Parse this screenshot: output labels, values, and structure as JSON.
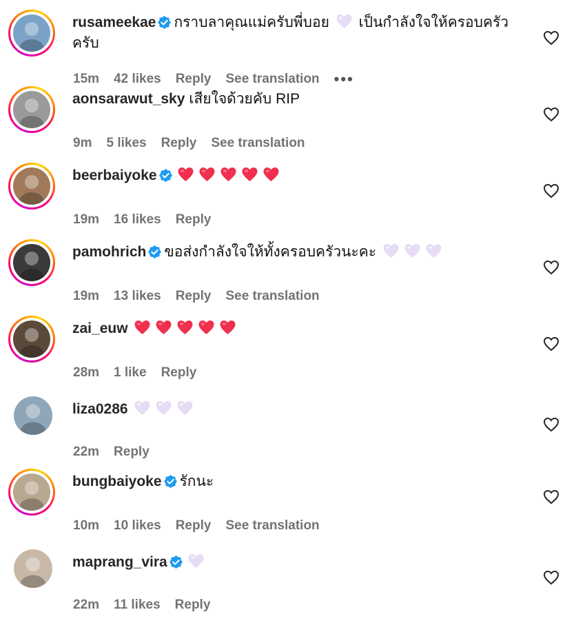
{
  "colors": {
    "red_heart": "#f0304e",
    "lavender_heart": "#e6dcf5",
    "verified_blue": "#1d9bf0",
    "meta_gray": "#737373"
  },
  "comments": [
    {
      "username": "rusameekae",
      "verified": true,
      "text": "กราบลาคุณแม่ครับพี่บอย",
      "hearts": [
        "lavender"
      ],
      "text_after": "เป็นกำลังใจให้ครอบครัวครับ",
      "time": "15m",
      "likes": "42 likes",
      "reply": "Reply",
      "translation": "See translation",
      "more": "•••",
      "story_ring": true,
      "avatar_color": "#7aa3c7"
    },
    {
      "username": "aonsarawut_sky",
      "verified": false,
      "text": "เสียใจด้วยคับ RIP",
      "hearts": [],
      "time": "9m",
      "likes": "5 likes",
      "reply": "Reply",
      "translation": "See translation",
      "story_ring": true,
      "avatar_color": "#9a9a9a"
    },
    {
      "username": "beerbaiyoke",
      "verified": true,
      "text": "",
      "hearts": [
        "red",
        "red",
        "red",
        "red",
        "red"
      ],
      "time": "19m",
      "likes": "16 likes",
      "reply": "Reply",
      "story_ring": true,
      "avatar_color": "#a07a5a"
    },
    {
      "username": "pamohrich",
      "verified": true,
      "text": "ขอส่งกำลังใจให้ทั้งครอบครัวนะคะ",
      "hearts": [
        "lavender",
        "lavender",
        "lavender"
      ],
      "time": "19m",
      "likes": "13 likes",
      "reply": "Reply",
      "translation": "See translation",
      "story_ring": true,
      "avatar_color": "#3a3a3a"
    },
    {
      "username": "zai_euw",
      "verified": false,
      "text": "",
      "hearts": [
        "red",
        "red",
        "red",
        "red",
        "red"
      ],
      "time": "28m",
      "likes": "1 like",
      "reply": "Reply",
      "story_ring": true,
      "avatar_color": "#5a4a3a"
    },
    {
      "username": "liza0286",
      "verified": false,
      "text": "",
      "hearts": [
        "lavender",
        "lavender",
        "lavender"
      ],
      "time": "22m",
      "reply": "Reply",
      "story_ring": false,
      "avatar_color": "#8ea6b8"
    },
    {
      "username": "bungbaiyoke",
      "verified": true,
      "text": "รักนะ",
      "hearts": [],
      "time": "10m",
      "likes": "10 likes",
      "reply": "Reply",
      "translation": "See translation",
      "story_ring": true,
      "avatar_color": "#b8a890"
    },
    {
      "username": "maprang_vira",
      "verified": true,
      "text": "",
      "hearts": [
        "lavender"
      ],
      "time": "22m",
      "likes": "11 likes",
      "reply": "Reply",
      "story_ring": false,
      "avatar_color": "#c8b8a8"
    }
  ]
}
